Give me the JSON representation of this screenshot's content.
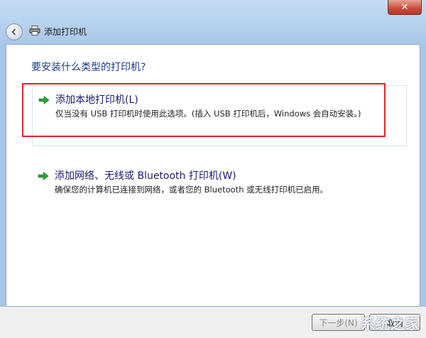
{
  "window": {
    "title": "添加打印机",
    "close_label": "✕"
  },
  "question": "要安装什么类型的打印机?",
  "options": [
    {
      "title": "添加本地打印机(L)",
      "description": "仅当没有 USB 打印机时使用此选项。(插入 USB 打印机后，Windows 会自动安装。)"
    },
    {
      "title": "添加网络、无线或 Bluetooth 打印机(W)",
      "description": "确保您的计算机已连接到网络，或者您的 Bluetooth 或无线打印机已启用。"
    }
  ],
  "buttons": {
    "next": "下一步(N)",
    "cancel": "取消"
  },
  "watermark": "系统之家",
  "colors": {
    "highlight": "#e0242a",
    "arrow": "#2e9e3a",
    "title_text": "#1d3f8a"
  },
  "icons": {
    "back": "back-arrow-icon",
    "printer": "printer-icon",
    "option_arrow": "green-arrow-icon",
    "close": "close-icon"
  }
}
